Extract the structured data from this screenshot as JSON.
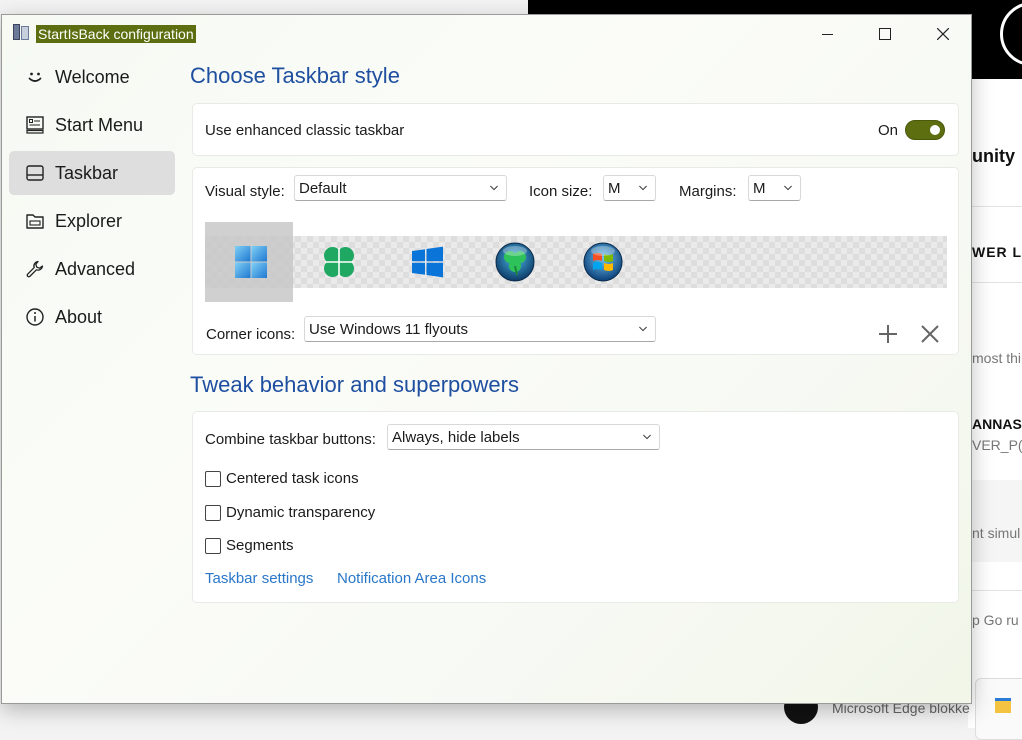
{
  "background": {
    "snippets": [
      {
        "text": "unity",
        "bold": true
      },
      {
        "text": "WER LA",
        "bold": true
      },
      {
        "text": "most thin",
        "bold": false
      },
      {
        "text": "ANNAS",
        "bold": true
      },
      {
        "text": "VER_P(",
        "bold": false
      },
      {
        "text": "nt simul",
        "bold": false
      },
      {
        "text": "p Go ru",
        "bold": false
      }
    ],
    "edge_text": "Microsoft Edge blokke"
  },
  "window": {
    "title": "StartIsBack configuration",
    "accent_color": "#5c6e10",
    "title_color": "#1e4fa0",
    "link_color": "#2a77c9"
  },
  "sidebar": {
    "items": [
      {
        "label": "Welcome",
        "icon": "smile-icon",
        "active": false
      },
      {
        "label": "Start Menu",
        "icon": "start-menu-icon",
        "active": false
      },
      {
        "label": "Taskbar",
        "icon": "taskbar-icon",
        "active": true
      },
      {
        "label": "Explorer",
        "icon": "folder-icon",
        "active": false
      },
      {
        "label": "Advanced",
        "icon": "wrench-icon",
        "active": false
      },
      {
        "label": "About",
        "icon": "info-icon",
        "active": false
      }
    ]
  },
  "taskbar_style": {
    "title": "Choose Taskbar style",
    "enhanced_label": "Use enhanced classic taskbar",
    "enhanced_state": "On",
    "enhanced_on": true,
    "visual_style_label": "Visual style:",
    "visual_style_value": "Default",
    "icon_size_label": "Icon size:",
    "icon_size_value": "M",
    "margins_label": "Margins:",
    "margins_value": "M",
    "styles": [
      {
        "icon": "windows11-logo-icon",
        "selected": true
      },
      {
        "icon": "clover-icon",
        "selected": false
      },
      {
        "icon": "windows10-logo-icon",
        "selected": false
      },
      {
        "icon": "clover-orb-icon",
        "selected": false
      },
      {
        "icon": "windows7-orb-icon",
        "selected": false
      }
    ],
    "corner_icons_label": "Corner icons:",
    "corner_icons_value": "Use Windows 11 flyouts"
  },
  "behavior": {
    "title": "Tweak behavior and superpowers",
    "combine_label": "Combine taskbar buttons:",
    "combine_value": "Always, hide labels",
    "checkboxes": [
      {
        "label": "Centered task icons",
        "checked": false
      },
      {
        "label": "Dynamic transparency",
        "checked": false
      },
      {
        "label": "Segments",
        "checked": false
      }
    ],
    "links": [
      "Taskbar settings",
      "Notification Area Icons"
    ]
  }
}
